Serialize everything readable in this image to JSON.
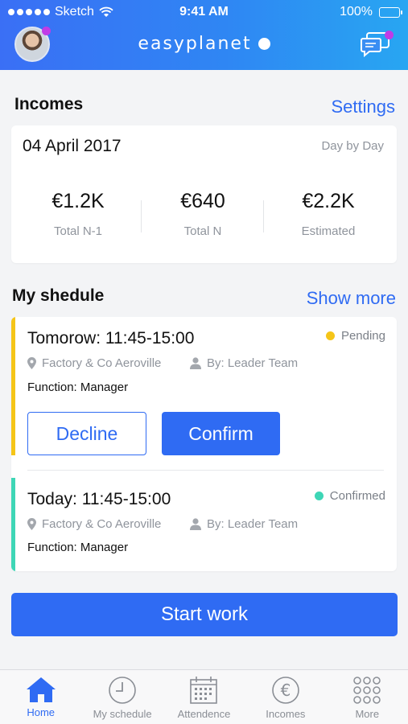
{
  "status_bar": {
    "carrier": "Sketch",
    "time": "9:41 AM",
    "battery": "100%"
  },
  "header": {
    "brand": "easyplanet"
  },
  "incomes": {
    "title": "Incomes",
    "settings_label": "Settings",
    "date": "04 April 2017",
    "mode": "Day by Day",
    "stats": [
      {
        "value": "€1.2K",
        "label": "Total N-1"
      },
      {
        "value": "€640",
        "label": "Total N"
      },
      {
        "value": "€2.2K",
        "label": "Estimated"
      }
    ]
  },
  "schedule": {
    "title": "My shedule",
    "show_more_label": "Show more",
    "items": [
      {
        "title": "Tomorow: 11:45-15:00",
        "status": "Pending",
        "status_color": "#f5c518",
        "location": "Factory & Co Aeroville",
        "by": "By: Leader Team",
        "function": "Function: Manager",
        "decline_label": "Decline",
        "confirm_label": "Confirm"
      },
      {
        "title": "Today: 11:45-15:00",
        "status": "Confirmed",
        "status_color": "#3ed6b6",
        "location": "Factory & Co Aeroville",
        "by": "By: Leader Team",
        "function": "Function: Manager"
      }
    ]
  },
  "start_work_label": "Start work",
  "tabs": [
    {
      "label": "Home",
      "icon": "home-icon",
      "active": true
    },
    {
      "label": "My schedule",
      "icon": "clock-icon",
      "active": false
    },
    {
      "label": "Attendence",
      "icon": "calendar-icon",
      "active": false
    },
    {
      "label": "Incomes",
      "icon": "euro-icon",
      "active": false
    },
    {
      "label": "More",
      "icon": "grid-icon",
      "active": false
    }
  ],
  "colors": {
    "primary": "#2f6bf3",
    "pending": "#f5c518",
    "confirmed": "#3ed6b6",
    "notification": "#c03be6"
  }
}
